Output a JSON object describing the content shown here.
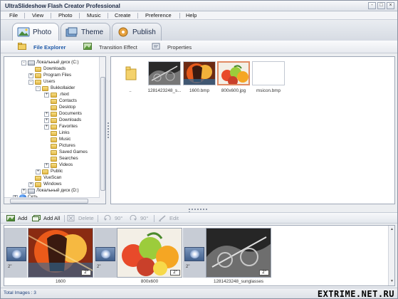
{
  "window": {
    "title": "UltraSlideshow Flash Creator Professional",
    "controls": [
      "-",
      "□",
      "×"
    ]
  },
  "menu": [
    "File",
    "View",
    "Photo",
    "Music",
    "Create",
    "Preference",
    "Help"
  ],
  "main_tabs": [
    {
      "label": "Photo",
      "icon": "photo-icon",
      "active": true
    },
    {
      "label": "Theme",
      "icon": "theme-icon",
      "active": false
    },
    {
      "label": "Publish",
      "icon": "publish-icon",
      "active": false
    }
  ],
  "sub_tabs": [
    {
      "label": "File Explorer",
      "icon": "file-explorer-icon",
      "active": true
    },
    {
      "label": "Transition Effect",
      "icon": "transition-effect-icon",
      "active": false
    },
    {
      "label": "Properties",
      "icon": "properties-icon",
      "active": false
    }
  ],
  "tree": [
    {
      "label": "Локальный диск (C:)",
      "type": "drive",
      "expander": "-"
    },
    {
      "label": "Downloads",
      "type": "folder",
      "expander": ""
    },
    {
      "label": "Program Files",
      "type": "folder",
      "expander": "+"
    },
    {
      "label": "Users",
      "type": "folder",
      "expander": "-"
    },
    {
      "label": "Bukkollaider",
      "type": "folder",
      "expander": "-"
    },
    {
      "label": ".rtext",
      "type": "folder",
      "expander": "+"
    },
    {
      "label": "Contacts",
      "type": "folder",
      "expander": ""
    },
    {
      "label": "Desktop",
      "type": "folder",
      "expander": ""
    },
    {
      "label": "Documents",
      "type": "folder",
      "expander": "+"
    },
    {
      "label": "Downloads",
      "type": "folder",
      "expander": "+"
    },
    {
      "label": "Favorites",
      "type": "folder",
      "expander": "+"
    },
    {
      "label": "Links",
      "type": "folder",
      "expander": ""
    },
    {
      "label": "Music",
      "type": "folder",
      "expander": ""
    },
    {
      "label": "Pictures",
      "type": "folder",
      "expander": ""
    },
    {
      "label": "Saved Games",
      "type": "folder",
      "expander": ""
    },
    {
      "label": "Searches",
      "type": "folder",
      "expander": ""
    },
    {
      "label": "Videos",
      "type": "folder",
      "expander": "+"
    },
    {
      "label": "Public",
      "type": "folder",
      "expander": "+"
    },
    {
      "label": "VueScan",
      "type": "folder",
      "expander": ""
    },
    {
      "label": "Windows",
      "type": "folder",
      "expander": "+"
    },
    {
      "label": "Локальный диск (D:)",
      "type": "drive",
      "expander": "+"
    },
    {
      "label": "Сеть",
      "type": "network",
      "expander": "+"
    }
  ],
  "files": [
    {
      "caption": "..",
      "kind": "folder",
      "selected": false
    },
    {
      "caption": "1281423248_s...",
      "kind": "photo-bw",
      "selected": false
    },
    {
      "caption": "1600.bmp",
      "kind": "photo-color-splash",
      "selected": false
    },
    {
      "caption": "800x600.jpg",
      "kind": "photo-fruit",
      "selected": true
    },
    {
      "caption": "msicon.bmp",
      "kind": "blank",
      "selected": false
    }
  ],
  "toolbar": [
    {
      "label": "Add",
      "icon": "add-photo-icon",
      "enabled": true
    },
    {
      "label": "Add All",
      "icon": "add-all-icon",
      "enabled": true
    },
    {
      "label": "Delete",
      "icon": "delete-icon",
      "enabled": false
    },
    {
      "label": "90°",
      "icon": "rotate-left-icon",
      "enabled": false
    },
    {
      "label": "90°",
      "icon": "rotate-right-icon",
      "enabled": false
    },
    {
      "label": "Edit",
      "icon": "edit-icon",
      "enabled": false
    }
  ],
  "storyboard": {
    "slides": [
      {
        "caption": "1600",
        "duration": "2\"",
        "kind": "photo-color-splash"
      },
      {
        "caption": "800x600",
        "duration": "2\"",
        "kind": "photo-fruit"
      },
      {
        "caption": "1281423248_sunglasses",
        "duration": "2\"",
        "kind": "photo-bw"
      }
    ],
    "transition_duration": "2\""
  },
  "status": {
    "text": "Total Images : 3"
  },
  "watermark": "EXTRIME.NET.RU",
  "colors": {
    "accent": "#1f5aa8",
    "selection": "#e08a63"
  }
}
